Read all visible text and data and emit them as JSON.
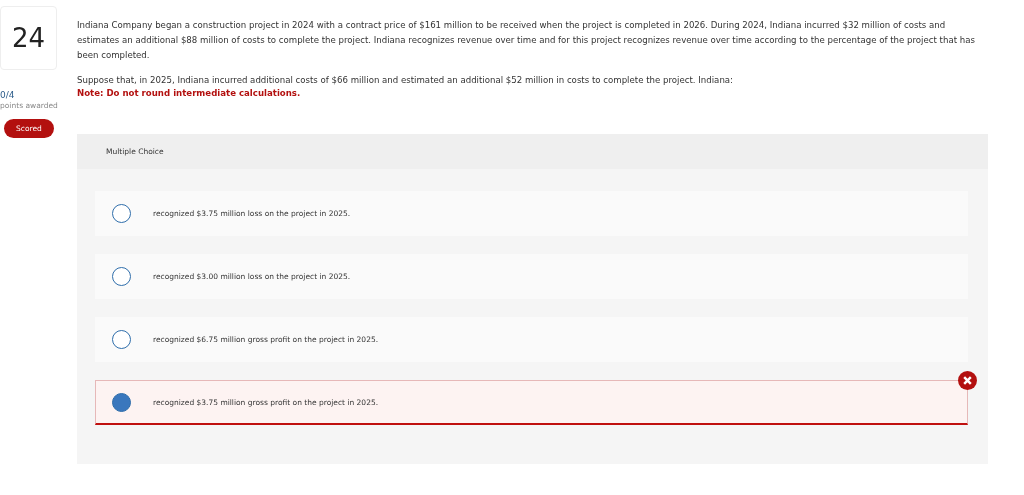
{
  "question": {
    "number": "24",
    "score": "0/4",
    "score_label": "points awarded",
    "status": "Scored"
  },
  "paragraphs": [
    "Indiana Company began a construction project in 2024 with a contract price of $161 million to be received when the project is completed in 2026. During 2024, Indiana incurred $32 million of costs and estimates an additional $88 million of costs to complete the project. Indiana recognizes revenue over time and for this project recognizes revenue over time according to the percentage of the project that has been completed.",
    "Suppose that, in 2025, Indiana incurred additional costs of $66 million and estimated an additional $52 million in costs to complete the project. Indiana:"
  ],
  "note": "Note: Do not round intermediate calculations.",
  "choices": {
    "heading": "Multiple Choice",
    "options": [
      {
        "text": "recognized $3.75 million loss on the project in 2025.",
        "selected": false,
        "incorrect": false
      },
      {
        "text": "recognized $3.00 million loss on the project in 2025.",
        "selected": false,
        "incorrect": false
      },
      {
        "text": "recognized $6.75 million gross profit on the project in 2025.",
        "selected": false,
        "incorrect": false
      },
      {
        "text": "recognized $3.75 million gross profit on the project in 2025.",
        "selected": true,
        "incorrect": true
      }
    ]
  }
}
